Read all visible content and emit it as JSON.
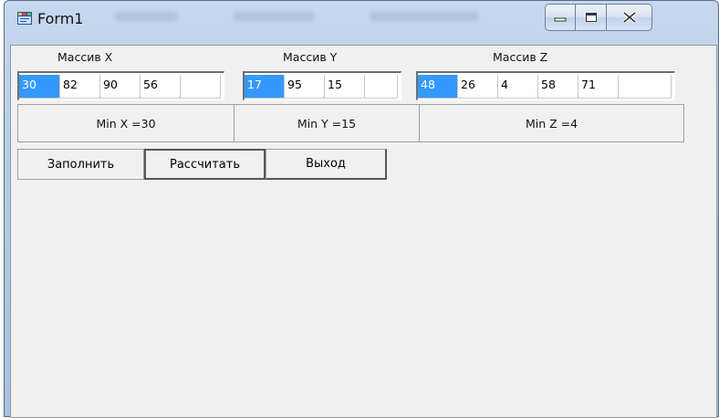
{
  "window": {
    "title": "Form1",
    "controls": {
      "minimize_icon": "minimize-icon",
      "maximize_icon": "maximize-icon",
      "close_icon": "close-icon"
    }
  },
  "arrays": {
    "x": {
      "label": "Массив X",
      "cells": [
        "30",
        "82",
        "90",
        "56",
        ""
      ]
    },
    "y": {
      "label": "Массив Y",
      "cells": [
        "17",
        "95",
        "15",
        ""
      ]
    },
    "z": {
      "label": "Массив Z",
      "cells": [
        "48",
        "26",
        "4",
        "58",
        "71",
        ""
      ]
    }
  },
  "results": {
    "min_x": "Min X =30",
    "min_y": "Min Y =15",
    "min_z": "Min Z =4"
  },
  "buttons": {
    "fill": "Заполнить",
    "calculate": "Рассчитать",
    "exit": "Выход"
  },
  "colors": {
    "selection": "#3399ff",
    "form_background": "#f0f0f0"
  }
}
